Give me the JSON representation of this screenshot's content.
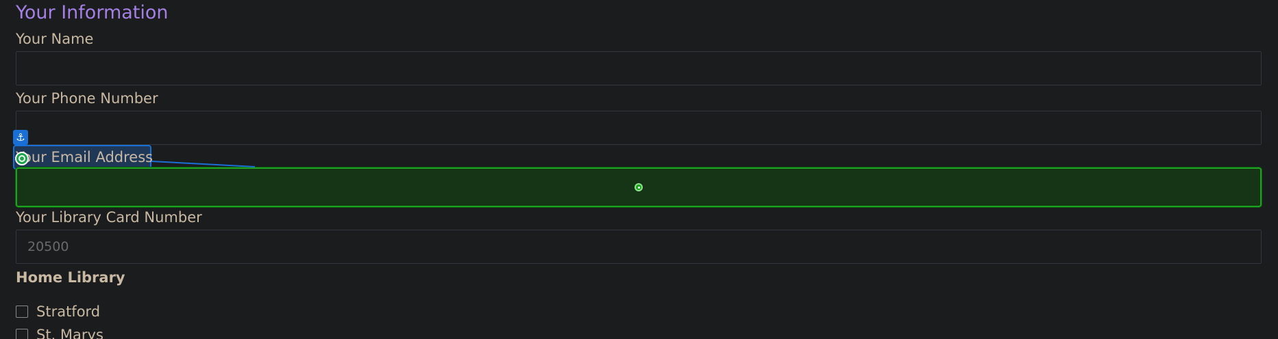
{
  "section": {
    "title": "Your Information"
  },
  "fields": {
    "name": {
      "label": "Your Name",
      "value": "",
      "placeholder": ""
    },
    "phone": {
      "label": "Your Phone Number",
      "value": "",
      "placeholder": ""
    },
    "email": {
      "label": "Your Email Address",
      "value": "",
      "placeholder": ""
    },
    "library_card": {
      "label": "Your Library Card Number",
      "value": "",
      "placeholder": "20500"
    }
  },
  "home_library": {
    "title": "Home Library",
    "options": [
      {
        "label": "Stratford",
        "checked": false
      },
      {
        "label": "St. Marys",
        "checked": false
      }
    ]
  },
  "overlay": {
    "anchor_icon": "anchor-icon",
    "target_icon": "target-icon",
    "label_highlight_color": "#1a6fd6",
    "field_highlight_color": "#1fa21f"
  },
  "colors": {
    "background": "#1b1c1e",
    "title": "#a580e4",
    "label": "#c9b9a3",
    "input_border": "#32363d"
  }
}
